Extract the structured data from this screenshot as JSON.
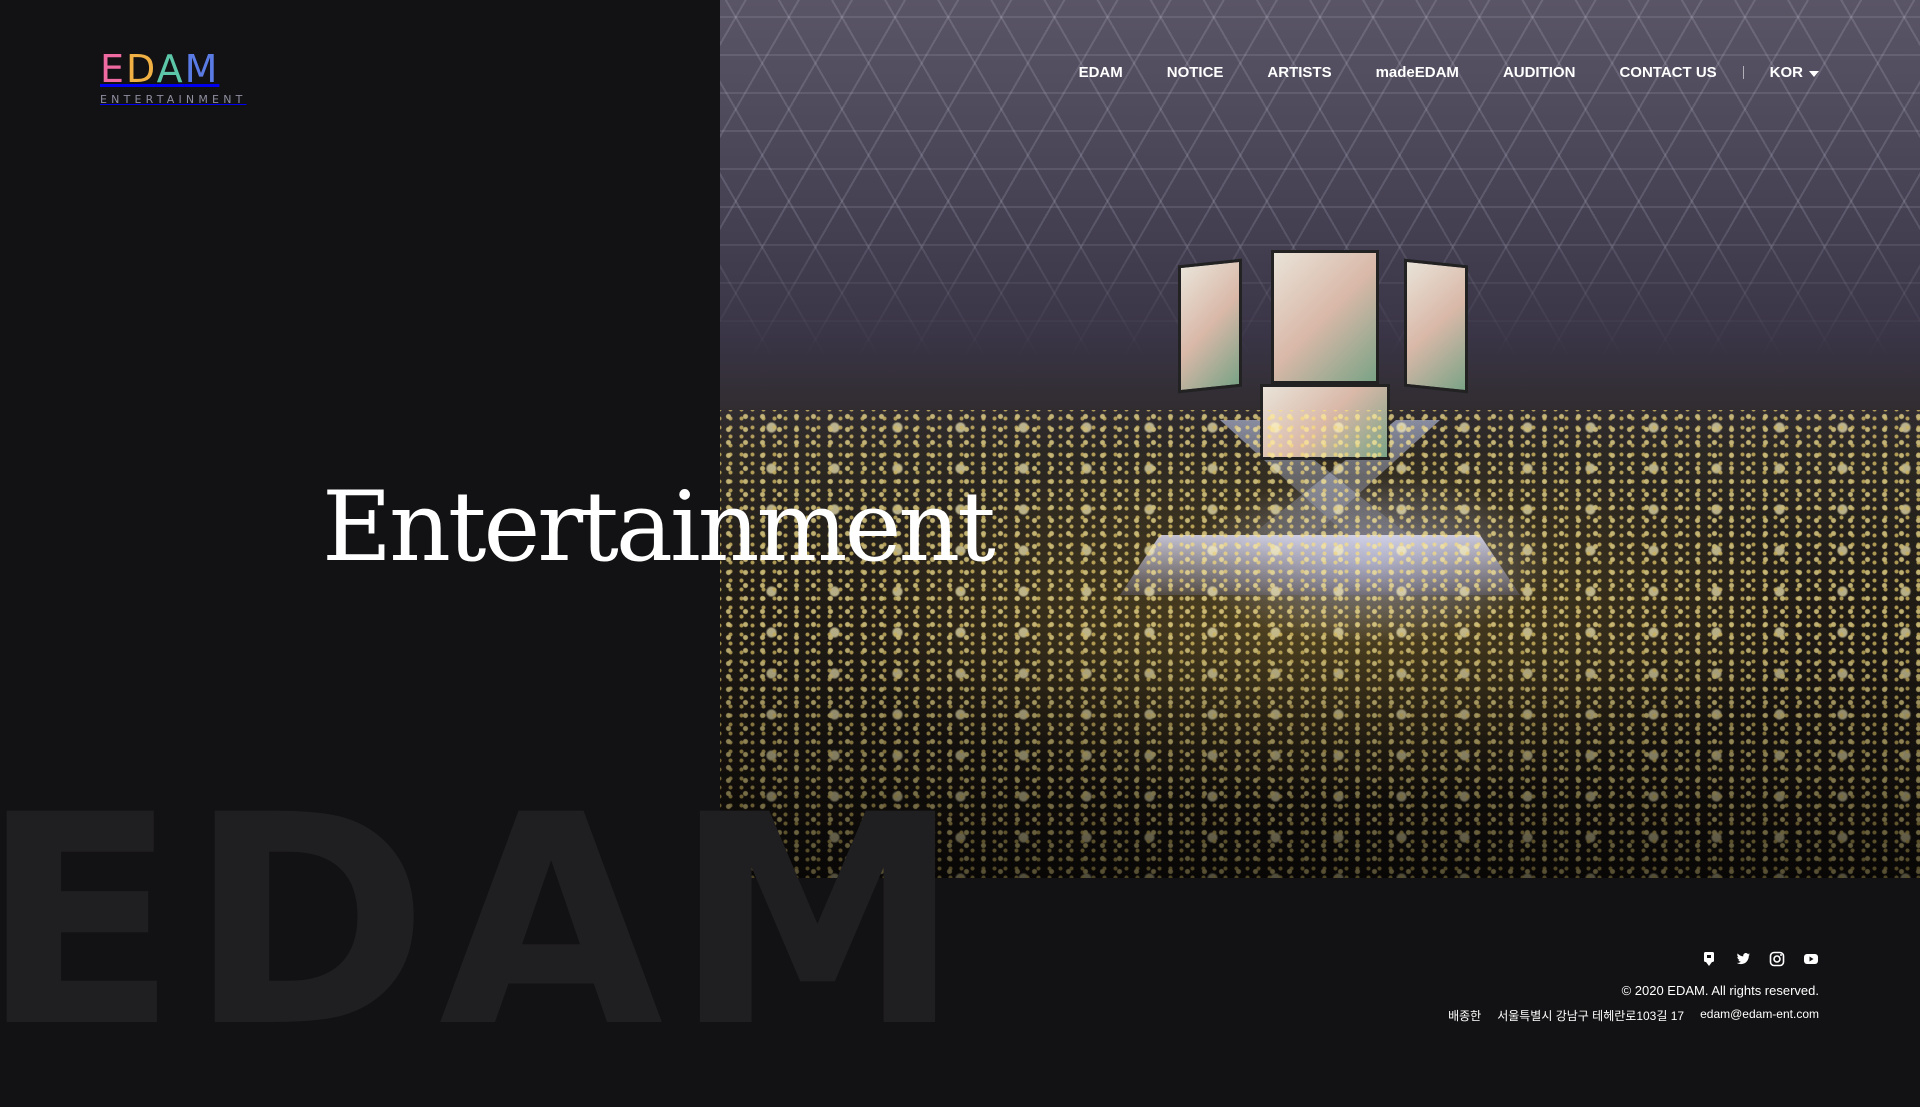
{
  "header": {
    "logo": {
      "letters": [
        "E",
        "D",
        "A",
        "M"
      ],
      "subtitle": "ENTERTAINMENT",
      "colors": [
        "#ef6aa0",
        "#f0b043",
        "#5bc7a8",
        "#5a7be4"
      ]
    },
    "nav": {
      "items": [
        {
          "label": "EDAM"
        },
        {
          "label": "NOTICE"
        },
        {
          "label": "ARTISTS"
        },
        {
          "label": "madeEDAM"
        },
        {
          "label": "AUDITION"
        },
        {
          "label": "CONTACT US"
        }
      ],
      "language": {
        "selected": "KOR",
        "icon": "caret-down-icon"
      }
    }
  },
  "hero": {
    "headline": "Entertainment",
    "image_subject": "concert-arena-photo",
    "watermark": "EDAM"
  },
  "footer": {
    "social": [
      {
        "name": "channel-icon"
      },
      {
        "name": "twitter-icon"
      },
      {
        "name": "instagram-icon"
      },
      {
        "name": "youtube-icon"
      }
    ],
    "copyright": "© 2020 EDAM. All rights reserved.",
    "ceo": "배종한",
    "address": "서울특별시 강남구 테헤란로103길 17",
    "email": "edam@edam-ent.com"
  },
  "colors": {
    "background": "#121113",
    "watermark": "#1f1e20",
    "text": "#ffffff"
  }
}
